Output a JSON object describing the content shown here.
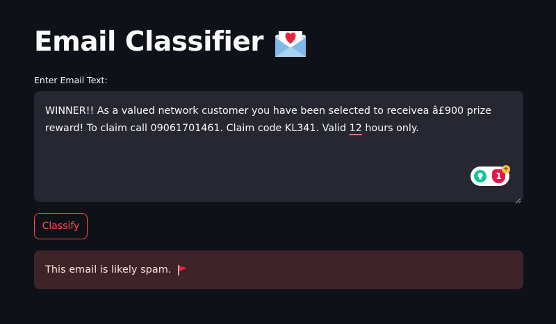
{
  "page": {
    "title": "Email Classifier",
    "title_icon": "love-letter-icon"
  },
  "input": {
    "label": "Enter Email Text:",
    "value": "WINNER!! As a valued network customer you have been selected to receivea â£900 prize reward! To claim call 09061701461. Claim code KL341. Valid 12 hours only.",
    "misspelled_word": "12"
  },
  "grammar_widget": {
    "suggestion_count": "1",
    "plus_symbol": "+"
  },
  "actions": {
    "classify_label": "Classify"
  },
  "result": {
    "message": "This email is likely spam.",
    "icon": "red-flag-icon"
  },
  "colors": {
    "background": "#0e1117",
    "input_background": "#262730",
    "accent": "#ff4b4b",
    "error_background": "#3e2428",
    "error_text": "#ffdede"
  }
}
